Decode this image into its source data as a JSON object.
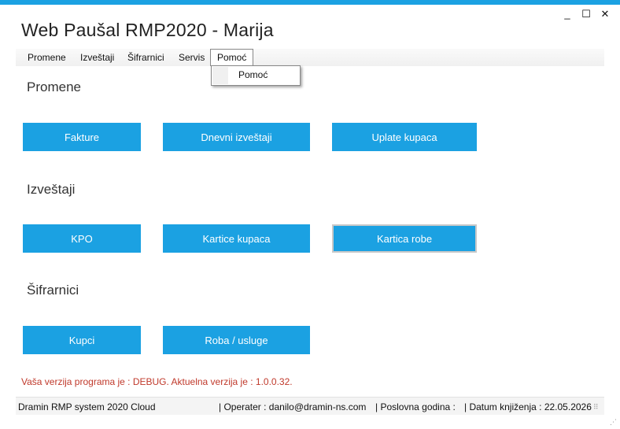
{
  "window": {
    "title": "Web Paušal RMP2020 - Marija",
    "controls": {
      "minimize": "_",
      "maximize": "☐",
      "close": "✕"
    }
  },
  "menu": {
    "items": [
      "Promene",
      "Izveštaji",
      "Šifrarnici",
      "Servis",
      "Pomoć"
    ],
    "open_item": "Pomoć",
    "dropdown_items": [
      "Pomoć"
    ]
  },
  "sections": {
    "promene": {
      "title": "Promene",
      "buttons": [
        "Fakture",
        "Dnevni izveštaji",
        "Uplate kupaca"
      ]
    },
    "izvestaji": {
      "title": "Izveštaji",
      "buttons": [
        "KPO",
        "Kartice kupaca",
        "Kartica robe"
      ]
    },
    "sifrarnici": {
      "title": "Šifrarnici",
      "buttons": [
        "Kupci",
        "Roba / usluge"
      ]
    }
  },
  "version_message": "Vaša verzija programa je : DEBUG. Aktuelna verzija je : 1.0.0.32.",
  "status": {
    "app": "Dramin RMP system 2020 Cloud",
    "operater": "|  Operater : danilo@dramin-ns.com",
    "godina": "|  Poslovna godina :",
    "datum": "|  Datum knjiženja : 22.05.2026"
  },
  "colors": {
    "accent": "#1ba1e2",
    "version_text": "#c0392b"
  }
}
